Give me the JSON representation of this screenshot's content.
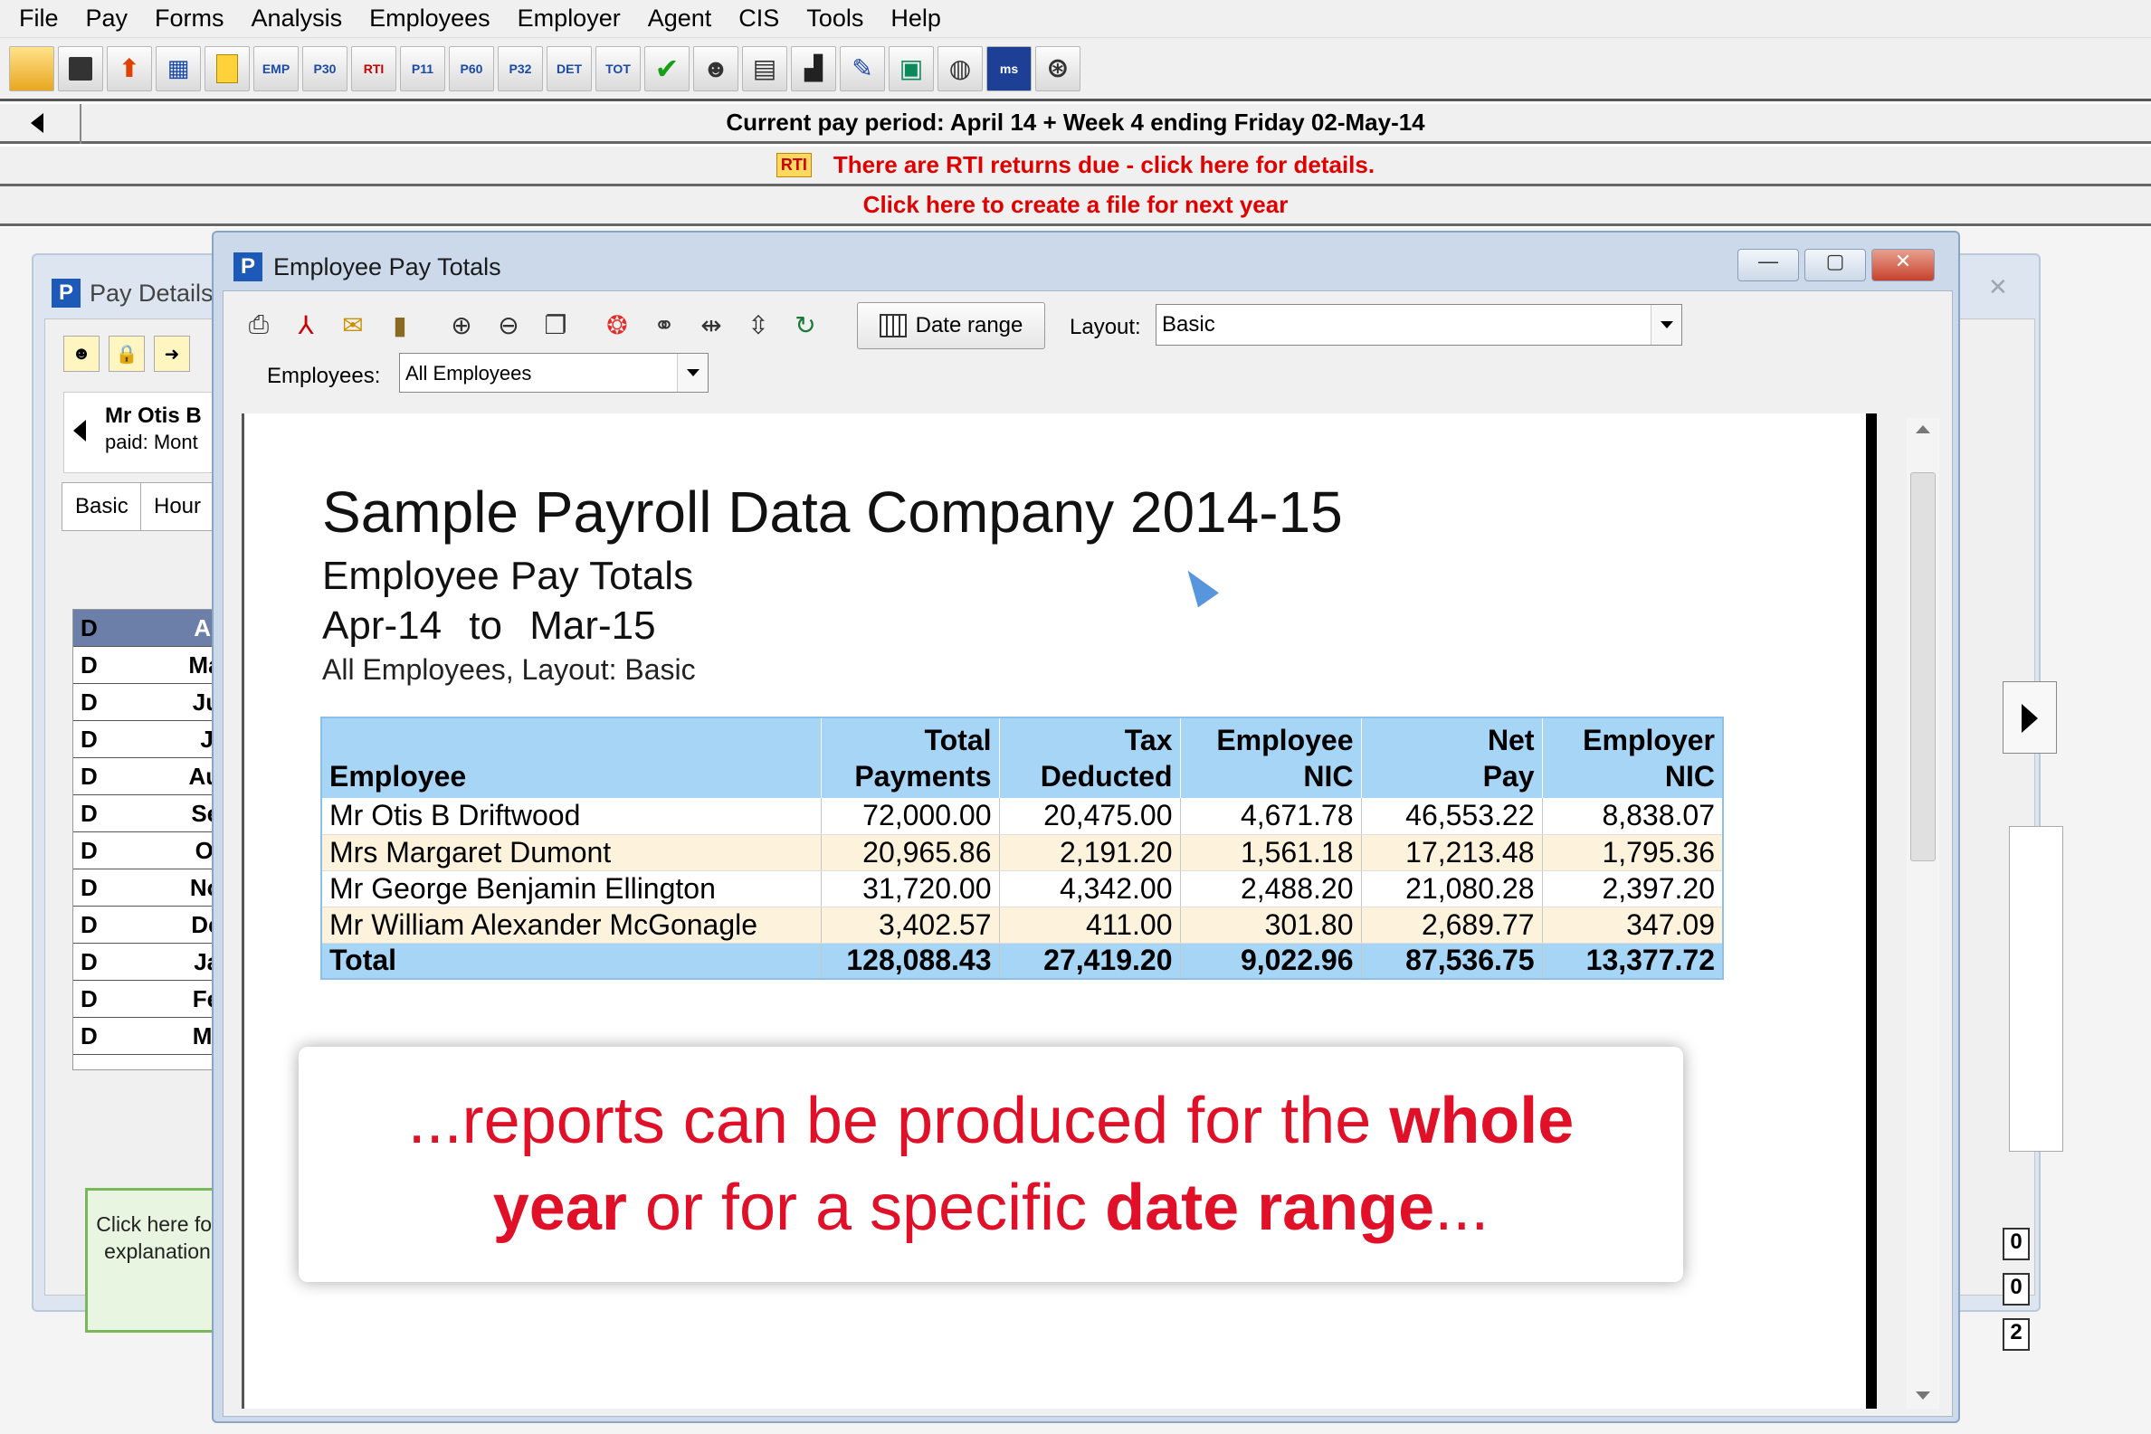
{
  "menu": [
    "File",
    "Pay",
    "Forms",
    "Analysis",
    "Employees",
    "Employer",
    "Agent",
    "CIS",
    "Tools",
    "Help"
  ],
  "toolbar_icons": [
    "open-folder-icon",
    "save-icon",
    "export-icon",
    "calculator-icon",
    "yellow-doc-icon",
    "EMP",
    "P30",
    "RTI",
    "P11",
    "P60",
    "P32",
    "DET",
    "TOT",
    "checkmark-icon",
    "user-icon",
    "ledger-icon",
    "factory-icon",
    "wrench-icon",
    "screen-icon",
    "globe-icon",
    "ms-icon",
    "settings-icon"
  ],
  "toolbar_labels": {
    "emp": "EMP",
    "p30": "P30",
    "rti": "RTI",
    "p11": "P11",
    "p60": "P60",
    "p32": "P32",
    "det": "DET",
    "tot": "TOT",
    "ms": "ms"
  },
  "status": {
    "pay_period": "Current pay period: April 14 + Week 4 ending Friday 02-May-14",
    "rti_icon_label": "RTI",
    "rti_notice": "There are RTI returns due - click here for details.",
    "next_year": "Click here to create a file for next year"
  },
  "pay_details": {
    "title": "Pay Details",
    "employee_name": "Mr Otis B",
    "paid": "paid: Mont",
    "tabs": [
      "Basic",
      "Hour"
    ],
    "month_code": "D",
    "months": [
      "Apr",
      "May",
      "Jun",
      "Jul",
      "Aug",
      "Sep",
      "Oct",
      "Nov",
      "Dec",
      "Jan",
      "Feb",
      "Mar"
    ],
    "explanation": "Click here for explanation",
    "right_values": [
      "0",
      "0",
      "2"
    ]
  },
  "dialog": {
    "logo": "P",
    "title": "Employee Pay Totals",
    "date_range_label": "Date range",
    "layout_label": "Layout:",
    "layout_value": "Basic",
    "employees_label": "Employees:",
    "employees_value": "All Employees"
  },
  "report": {
    "title": "Sample Payroll Data Company 2014-15",
    "subtitle": "Employee Pay Totals",
    "range": "Apr-14 to Mar-15",
    "note": "All Employees, Layout: Basic",
    "headers": [
      [
        "",
        "Employee"
      ],
      [
        "Total",
        "Payments"
      ],
      [
        "Tax",
        "Deducted"
      ],
      [
        "Employee",
        "NIC"
      ],
      [
        "Net",
        "Pay"
      ],
      [
        "Employer",
        "NIC"
      ]
    ],
    "rows": [
      [
        "Mr Otis B Driftwood",
        "72,000.00",
        "20,475.00",
        "4,671.78",
        "46,553.22",
        "8,838.07"
      ],
      [
        "Mrs Margaret Dumont",
        "20,965.86",
        "2,191.20",
        "1,561.18",
        "17,213.48",
        "1,795.36"
      ],
      [
        "Mr George Benjamin Ellington",
        "31,720.00",
        "4,342.00",
        "2,488.20",
        "21,080.28",
        "2,397.20"
      ],
      [
        "Mr William Alexander McGonagle",
        "3,402.57",
        "411.00",
        "301.80",
        "2,689.77",
        "347.09"
      ]
    ],
    "total": [
      "Total",
      "128,088.43",
      "27,419.20",
      "9,022.96",
      "87,536.75",
      "13,377.72"
    ]
  },
  "callout": {
    "line1_a": "...reports can be produced for the ",
    "line1_b": "whole",
    "line2_a": "year",
    "line2_b": " or for a specific ",
    "line2_c": "date range",
    "line2_d": "..."
  },
  "colors": {
    "alert_red": "#e00000",
    "header_blue": "#a7d5f6",
    "alt_row": "#fdf3dc",
    "callout_red": "#e01028"
  }
}
